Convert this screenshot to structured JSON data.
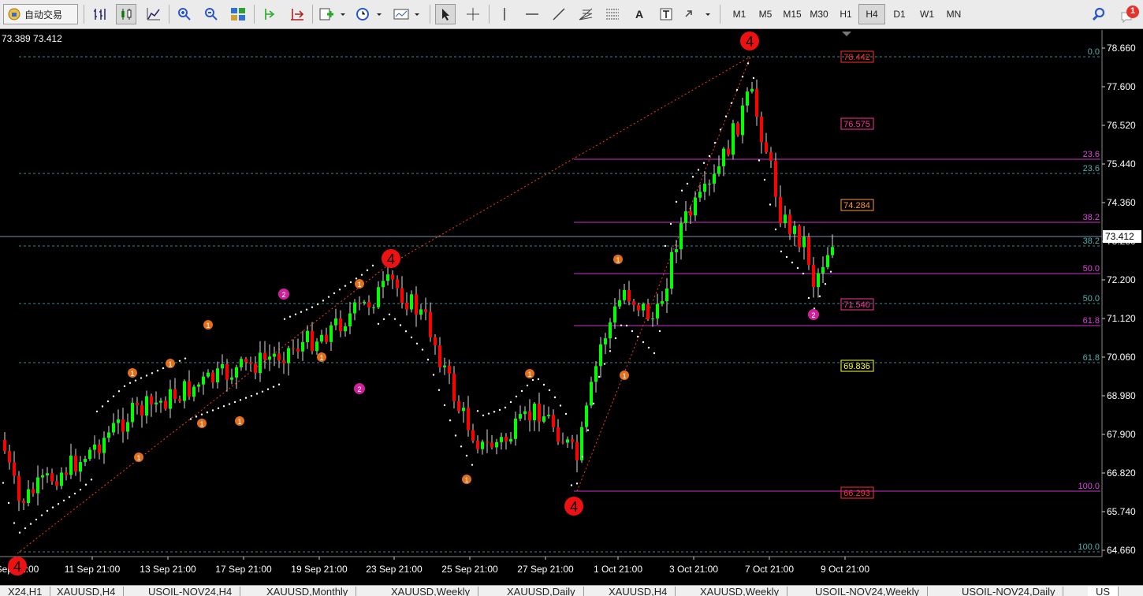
{
  "toolbar": {
    "auto_trading_label": "自动交易",
    "timeframes": [
      "M1",
      "M5",
      "M15",
      "M30",
      "H1",
      "H4",
      "D1",
      "W1",
      "MN"
    ],
    "active_timeframe": "H4",
    "notification_count": "1",
    "icons": [
      "bar-chart-icon",
      "candlestick-icon",
      "line-chart-icon",
      "zoom-in-icon",
      "zoom-out-icon",
      "tile-windows-icon",
      "chart-shift-icon",
      "autoscroll-icon",
      "new-order-icon",
      "periods-clock-icon",
      "templates-icon",
      "cursor-icon",
      "crosshair-icon",
      "vertical-line-icon",
      "horizontal-line-icon",
      "trendline-icon",
      "fibonacci-fan-icon",
      "fibonacci-icon",
      "text-icon",
      "text-label-icon",
      "arrows-icon",
      "search-icon",
      "notification-icon"
    ],
    "accent_color": "#2a56c6"
  },
  "chart": {
    "quote_text": "73.389 73.412",
    "current_price": "73.412",
    "price_axis_labels": [
      "78.660",
      "77.600",
      "76.520",
      "75.440",
      "74.360",
      "73.280",
      "72.200",
      "71.120",
      "70.060",
      "68.980",
      "67.900",
      "66.820",
      "65.740",
      "64.660"
    ],
    "time_axis_labels": [
      "Sep 21:00",
      "11 Sep 21:00",
      "13 Sep 21:00",
      "17 Sep 21:00",
      "19 Sep 21:00",
      "23 Sep 21:00",
      "25 Sep 21:00",
      "27 Sep 21:00",
      "1 Oct 21:00",
      "3 Oct 21:00",
      "7 Oct 21:00",
      "9 Oct 21:00"
    ],
    "fib_cyan_labels": [
      "0.0",
      "23.6",
      "38.2",
      "50.0",
      "61.8",
      "100.0"
    ],
    "fib_magenta_labels": [
      "23.6",
      "38.2",
      "50.0",
      "61.8",
      "100.0"
    ],
    "level_boxes": [
      {
        "text": "78.442",
        "color": "#ff3030"
      },
      {
        "text": "76.575",
        "color": "#ff3399"
      },
      {
        "text": "74.284",
        "color": "#ff9933"
      },
      {
        "text": "71.540",
        "color": "#ff3399"
      },
      {
        "text": "69.836",
        "color": "#ffff33"
      },
      {
        "text": "66.293",
        "color": "#ff3030"
      }
    ],
    "wave_labels": [
      "4",
      "4",
      "4",
      "4"
    ],
    "marker_labels": [
      "1",
      "2"
    ],
    "colors": {
      "bull": "#00ff00",
      "bear": "#ff0000",
      "fib_cyan": "#3c8c8c",
      "fib_magenta": "#cc33cc",
      "sar": "#ffffff"
    }
  },
  "tabs": [
    "X24,H1",
    "XAUUSD,H4",
    "USOIL-NOV24,H4",
    "XAUUSD,Monthly",
    "XAUUSD,Weekly",
    "XAUUSD,Daily",
    "XAUUSD,H4",
    "XAUUSD,Weekly",
    "USOIL-NOV24,Weekly",
    "USOIL-NOV24,Daily",
    "US"
  ]
}
